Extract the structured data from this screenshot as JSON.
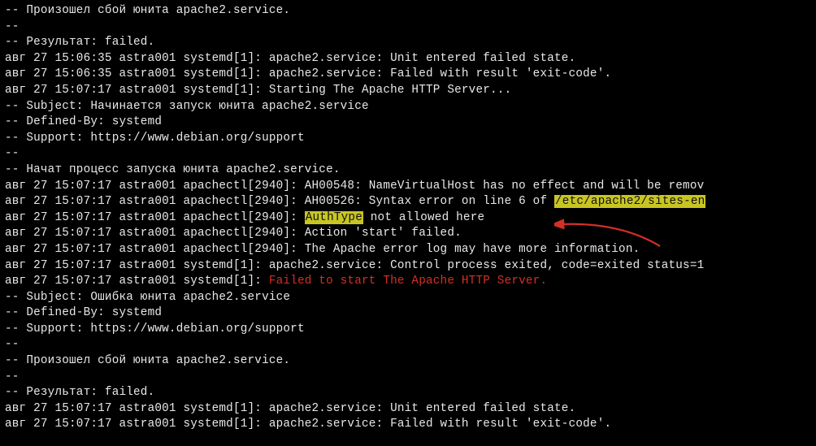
{
  "lines": [
    {
      "segments": [
        {
          "t": "-- Произошел сбой юнита apache2.service."
        }
      ]
    },
    {
      "segments": [
        {
          "t": "--"
        }
      ]
    },
    {
      "segments": [
        {
          "t": "-- Результат: failed."
        }
      ]
    },
    {
      "segments": [
        {
          "t": "авг 27 15:06:35 astra001 systemd[1]: apache2.service: Unit entered failed state."
        }
      ]
    },
    {
      "segments": [
        {
          "t": "авг 27 15:06:35 astra001 systemd[1]: apache2.service: Failed with result 'exit-code'."
        }
      ]
    },
    {
      "segments": [
        {
          "t": "авг 27 15:07:17 astra001 systemd[1]: Starting The Apache HTTP Server..."
        }
      ]
    },
    {
      "segments": [
        {
          "t": "-- Subject: Начинается запуск юнита apache2.service"
        }
      ]
    },
    {
      "segments": [
        {
          "t": "-- Defined-By: systemd"
        }
      ]
    },
    {
      "segments": [
        {
          "t": "-- Support: https://www.debian.org/support"
        }
      ]
    },
    {
      "segments": [
        {
          "t": "--"
        }
      ]
    },
    {
      "segments": [
        {
          "t": "-- Начат процесс запуска юнита apache2.service."
        }
      ]
    },
    {
      "segments": [
        {
          "t": "авг 27 15:07:17 astra001 apachectl[2940]: AH00548: NameVirtualHost has no effect and will be remov"
        }
      ]
    },
    {
      "segments": [
        {
          "t": "авг 27 15:07:17 astra001 apachectl[2940]: AH00526: Syntax error on line 6 of "
        },
        {
          "t": "/etc/apache2/sites-en",
          "cls": "hl"
        }
      ]
    },
    {
      "segments": [
        {
          "t": "авг 27 15:07:17 astra001 apachectl[2940]: "
        },
        {
          "t": "AuthType",
          "cls": "hl"
        },
        {
          "t": " not allowed here"
        }
      ]
    },
    {
      "segments": [
        {
          "t": "авг 27 15:07:17 astra001 apachectl[2940]: Action 'start' failed."
        }
      ]
    },
    {
      "segments": [
        {
          "t": "авг 27 15:07:17 astra001 apachectl[2940]: The Apache error log may have more information."
        }
      ]
    },
    {
      "segments": [
        {
          "t": "авг 27 15:07:17 astra001 systemd[1]: apache2.service: Control process exited, code=exited status=1"
        }
      ]
    },
    {
      "segments": [
        {
          "t": "авг 27 15:07:17 astra001 systemd[1]: "
        },
        {
          "t": "Failed to start The Apache HTTP Server.",
          "cls": "err"
        }
      ]
    },
    {
      "segments": [
        {
          "t": "-- Subject: Ошибка юнита apache2.service"
        }
      ]
    },
    {
      "segments": [
        {
          "t": "-- Defined-By: systemd"
        }
      ]
    },
    {
      "segments": [
        {
          "t": "-- Support: https://www.debian.org/support"
        }
      ]
    },
    {
      "segments": [
        {
          "t": "--"
        }
      ]
    },
    {
      "segments": [
        {
          "t": "-- Произошел сбой юнита apache2.service."
        }
      ]
    },
    {
      "segments": [
        {
          "t": "--"
        }
      ]
    },
    {
      "segments": [
        {
          "t": "-- Результат: failed."
        }
      ]
    },
    {
      "segments": [
        {
          "t": "авг 27 15:07:17 astra001 systemd[1]: apache2.service: Unit entered failed state."
        }
      ]
    },
    {
      "segments": [
        {
          "t": "авг 27 15:07:17 astra001 systemd[1]: apache2.service: Failed with result 'exit-code'."
        }
      ]
    }
  ],
  "annotations": {
    "arrow_color": "#d23026"
  }
}
